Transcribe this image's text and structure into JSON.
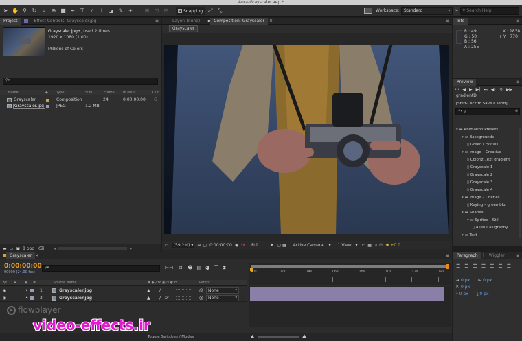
{
  "window": {
    "title": "Aura-Grayscaler.aep *"
  },
  "toolbar": {
    "snapping": "Snapping",
    "workspace_label": "Workspace:",
    "workspace_value": "Standard",
    "search_placeholder": "Search Help"
  },
  "project": {
    "tab": "Project",
    "effect_controls_tab": "Effect Controls: Grayscaler.jpg",
    "item_name": "Grayscaler.jpg",
    "item_used": ", used 2 times",
    "item_dims": "1920 x 1080 (1.00)",
    "item_colors": "Millions of Colors",
    "search_value": "",
    "columns": [
      "Name",
      "Type",
      "Size",
      "Frame ...",
      "In Point",
      "Out"
    ],
    "rows": [
      {
        "name": "Grayscaler",
        "type": "Composition",
        "size": "",
        "frame": "24",
        "inpoint": "0:00:00:00"
      },
      {
        "name": "Grayscaler.jpg",
        "type": "JPEG",
        "size": "1.2 MB",
        "frame": "",
        "inpoint": ""
      }
    ],
    "bpc": "8 bpc"
  },
  "viewer": {
    "layer_tab": "Layer: (none)",
    "comp_tab": "Composition: Grayscaler",
    "crumb": "Grayscaler",
    "zoom": "(59.2%)",
    "timecode": "0:00:00:00",
    "resolution": "Full",
    "camera": "Active Camera",
    "views": "1 View",
    "exposure": "+0.0"
  },
  "info": {
    "tab": "Info",
    "r": "R : 49",
    "g": "G : 50",
    "b": "B : 56",
    "a": "A : 255",
    "x": "X : 1838",
    "y": "+ Y : 770"
  },
  "preview": {
    "tab": "Preview",
    "search_value": "gradientD",
    "shift_hint": "[Shift-Click to Save a Term]",
    "search2_value": "gl"
  },
  "effects": [
    {
      "label": "Animation Presets",
      "indent": 0,
      "kind": "folder"
    },
    {
      "label": "Backgrounds",
      "indent": 1,
      "kind": "folder"
    },
    {
      "label": "Green Crystals",
      "indent": 2,
      "kind": "item"
    },
    {
      "label": "Image – Creative",
      "indent": 1,
      "kind": "folder"
    },
    {
      "label": "Coloriz...ext gradient",
      "indent": 2,
      "kind": "item"
    },
    {
      "label": "Grayscale 1",
      "indent": 2,
      "kind": "item"
    },
    {
      "label": "Grayscale 2",
      "indent": 2,
      "kind": "item"
    },
    {
      "label": "Grayscale 3",
      "indent": 2,
      "kind": "item"
    },
    {
      "label": "Grayscale 4",
      "indent": 2,
      "kind": "item"
    },
    {
      "label": "Image – Utilities",
      "indent": 1,
      "kind": "folder"
    },
    {
      "label": "Keying – green blur",
      "indent": 2,
      "kind": "item"
    },
    {
      "label": "Shapes",
      "indent": 1,
      "kind": "folder"
    },
    {
      "label": "Sprites – Still",
      "indent": 2,
      "kind": "folder"
    },
    {
      "label": "Alien Calligraphy",
      "indent": 3,
      "kind": "item"
    },
    {
      "label": "Text",
      "indent": 1,
      "kind": "folder"
    }
  ],
  "paragraph": {
    "tab": "Paragraph",
    "wiggler_tab": "Wiggler",
    "v1": "0 px",
    "v2": "0 px",
    "v3": "0 px",
    "v4": "0 px",
    "v5": "0 px"
  },
  "timeline": {
    "tab": "Grayscaler",
    "timecode": "0:00:00:00",
    "fps": "00000 (24.00 fps)",
    "source_name_header": "Source Name",
    "parent_header": "Parent",
    "ruler": [
      "0s",
      "02s",
      "04s",
      "06s",
      "08s",
      "10s",
      "12s",
      "14s"
    ],
    "layers": [
      {
        "num": "1",
        "name": "Grayscaler.jpg",
        "parent": "None"
      },
      {
        "num": "2",
        "name": "Grayscaler.jpg",
        "parent": "None"
      }
    ],
    "toggle_label": "Toggle Switches / Modes"
  },
  "watermarks": {
    "player": "flowplayer",
    "site": "video-effects.ir"
  },
  "colors": {
    "accent_orange": "#e58a1f",
    "timecode_orange": "#f2a21b",
    "track_purple": "#8a7fa6",
    "site_magenta": "#e01bd0"
  }
}
